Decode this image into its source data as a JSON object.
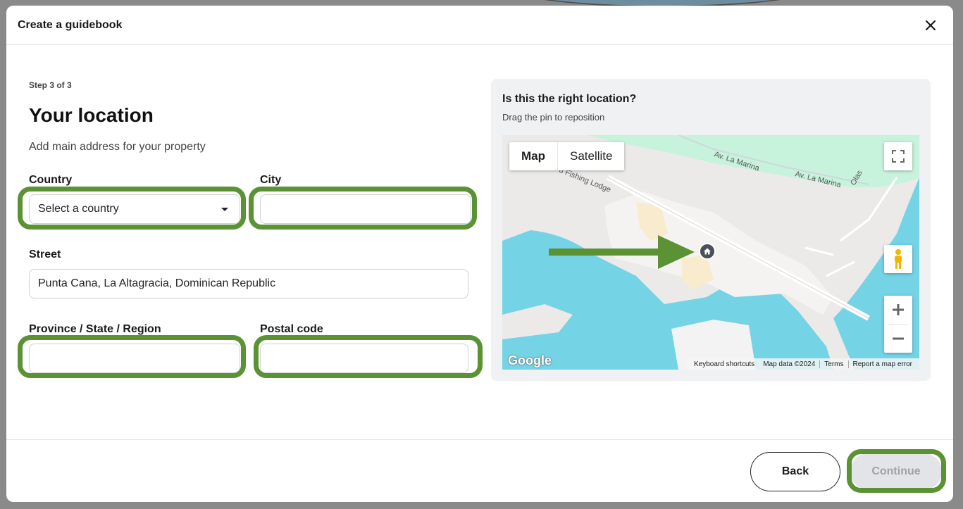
{
  "modal": {
    "title": "Create a guidebook"
  },
  "form": {
    "step": "Step 3 of 3",
    "title": "Your location",
    "subtitle": "Add main address for your property",
    "country": {
      "label": "Country",
      "value": "Select a country"
    },
    "city": {
      "label": "City",
      "value": ""
    },
    "street": {
      "label": "Street",
      "value": "Punta Cana, La Altagracia, Dominican Republic"
    },
    "province": {
      "label": "Province / State / Region",
      "value": ""
    },
    "postal": {
      "label": "Postal code",
      "value": ""
    }
  },
  "map": {
    "question": "Is this the right location?",
    "hint": "Drag the pin to reposition",
    "type_map": "Map",
    "type_satellite": "Satellite",
    "street_labels": [
      "Av. La Marina",
      "Av. La Marina",
      "Olas",
      "d Fishing Lodge"
    ],
    "logo": "Google",
    "attribution": [
      "Keyboard shortcuts",
      "Map data ©2024",
      "Terms",
      "Report a map error"
    ],
    "colors": {
      "water": "#75d3e6",
      "land": "#ebeae8",
      "park": "#c7f2dc",
      "road": "#ffffff"
    }
  },
  "footer": {
    "back": "Back",
    "continue": "Continue"
  },
  "colors": {
    "highlight": "#5a9234",
    "continue_bg": "#e3e4e8"
  }
}
